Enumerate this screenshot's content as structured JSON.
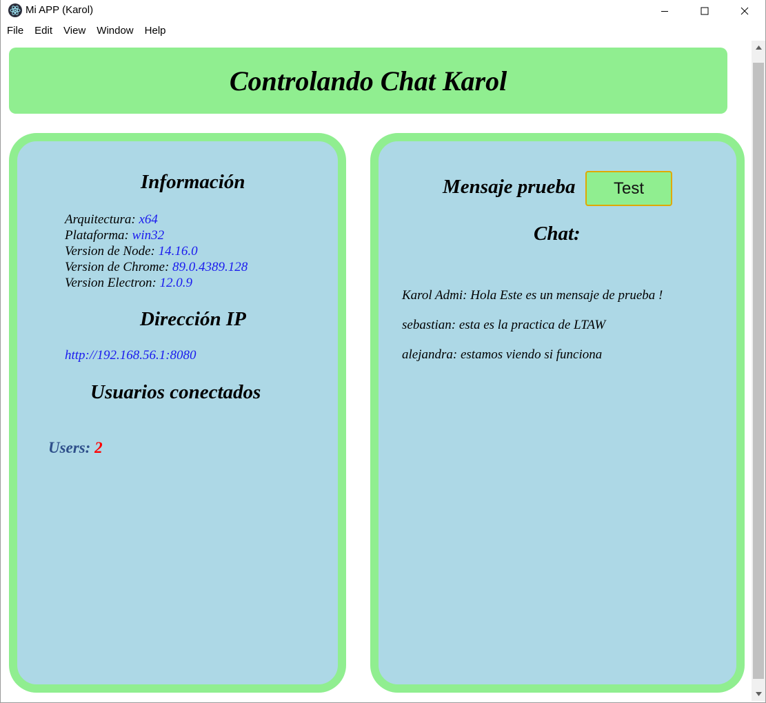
{
  "window": {
    "title": "Mi APP (Karol)",
    "app_icon": "electron-icon"
  },
  "menu": [
    "File",
    "Edit",
    "View",
    "Window",
    "Help"
  ],
  "header": {
    "title": "Controlando Chat Karol"
  },
  "info_panel": {
    "title": "Información",
    "items": [
      {
        "label": "Arquitectura: ",
        "value": "x64"
      },
      {
        "label": "Plataforma: ",
        "value": "win32"
      },
      {
        "label": "Version de Node: ",
        "value": "14.16.0"
      },
      {
        "label": "Version de Chrome: ",
        "value": "89.0.4389.128"
      },
      {
        "label": "Version Electron: ",
        "value": "12.0.9"
      }
    ],
    "ip_title": "Dirección IP",
    "ip_url": "http://192.168.56.1:8080",
    "users_title": "Usuarios conectados",
    "users_label": "Users: ",
    "users_count": "2"
  },
  "chat_panel": {
    "test_label": "Mensaje prueba",
    "test_button": "Test",
    "chat_title": "Chat:",
    "messages": [
      "Karol Admi: Hola Este es un mensaje de prueba !",
      "sebastian: esta es la practica de LTAW",
      "alejandra: estamos viendo si funciona"
    ]
  },
  "colors": {
    "green": "#90ee90",
    "light_blue": "#add8e6",
    "link_blue": "#1a1aee",
    "users_blue": "#2e4f8a",
    "count_red": "#ff0000"
  }
}
